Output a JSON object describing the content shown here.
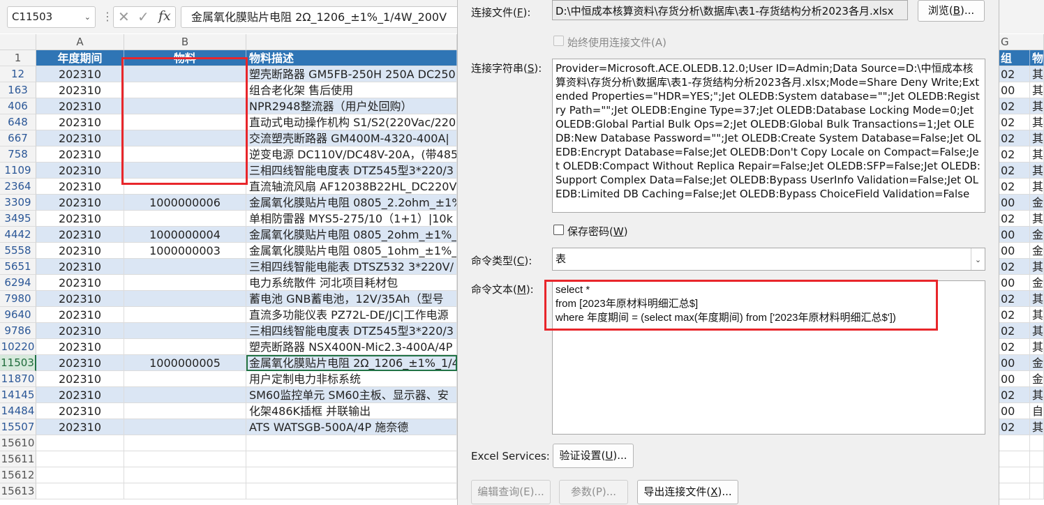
{
  "formula_bar": {
    "name_box": "C11503",
    "cancel_glyph": "✕",
    "enter_glyph": "✓",
    "fx_glyph": "fx",
    "formula": "金属氧化膜贴片电阻 2Ω_1206_±1%_1/4W_200V"
  },
  "columns": {
    "a": "A",
    "b": "B",
    "r": "G"
  },
  "table": {
    "header_row_number": "1",
    "header": {
      "period": "年度期间",
      "material": "物料",
      "description": "物料描述",
      "right_col": "组",
      "far_right": "物"
    },
    "rows": [
      {
        "row": "12",
        "period": "202310",
        "material": "",
        "desc": "塑壳断路器 GM5FB-250H 250A DC250",
        "r": "02",
        "s": "其"
      },
      {
        "row": "163",
        "period": "202310",
        "material": "",
        "desc": "组合老化架 售后使用",
        "r": "00",
        "s": "其"
      },
      {
        "row": "406",
        "period": "202310",
        "material": "",
        "desc": "NPR2948整流器（用户处回购）",
        "r": "02",
        "s": "其"
      },
      {
        "row": "648",
        "period": "202310",
        "material": "",
        "desc": "直动式电动操作机构 S1/S2(220Vac/220",
        "r": "02",
        "s": "其"
      },
      {
        "row": "667",
        "period": "202310",
        "material": "",
        "desc": "交流塑壳断路器 GM400M-4320-400A|",
        "r": "02",
        "s": "其"
      },
      {
        "row": "758",
        "period": "202310",
        "material": "",
        "desc": "逆变电源 DC110V/DC48V-20A，(带485",
        "r": "02",
        "s": "其"
      },
      {
        "row": "1109",
        "period": "202310",
        "material": "",
        "desc": "三相四线智能电度表 DTZ545型3*220/3",
        "r": "02",
        "s": "其"
      },
      {
        "row": "2364",
        "period": "202310",
        "material": "",
        "desc": "直流轴流风扇 AF12038B22HL_DC220V_",
        "r": "02",
        "s": "其"
      },
      {
        "row": "3309",
        "period": "202310",
        "material": "1000000006",
        "desc": "金属氧化膜贴片电阻 0805_2.2ohm_±1%",
        "r": "00",
        "s": "金"
      },
      {
        "row": "3495",
        "period": "202310",
        "material": "",
        "desc": "单相防雷器 MYS5-275/10（1+1）|10k",
        "r": "02",
        "s": "其"
      },
      {
        "row": "4442",
        "period": "202310",
        "material": "1000000004",
        "desc": "金属氧化膜贴片电阻 0805_2ohm_±1%_",
        "r": "00",
        "s": "金"
      },
      {
        "row": "5558",
        "period": "202310",
        "material": "1000000003",
        "desc": "金属氧化膜贴片电阻 0805_1ohm_±1%_",
        "r": "00",
        "s": "金"
      },
      {
        "row": "5651",
        "period": "202310",
        "material": "",
        "desc": "三相四线智能电能表 DTSZ532 3*220V/",
        "r": "02",
        "s": "其"
      },
      {
        "row": "6294",
        "period": "202310",
        "material": "",
        "desc": "电力系统散件 河北项目耗材包",
        "r": "00",
        "s": "金"
      },
      {
        "row": "7980",
        "period": "202310",
        "material": "",
        "desc": "蓄电池 GNB蓄电池，12V/35Ah（型号",
        "r": "02",
        "s": "其"
      },
      {
        "row": "9640",
        "period": "202310",
        "material": "",
        "desc": "直流多功能仪表 PZ72L-DE/JC|工作电源",
        "r": "02",
        "s": "其"
      },
      {
        "row": "9786",
        "period": "202310",
        "material": "",
        "desc": "三相四线智能电度表 DTZ545型3*220/3",
        "r": "02",
        "s": "其"
      },
      {
        "row": "10220",
        "period": "202310",
        "material": "",
        "desc": "塑壳断路器 NSX400N-Mic2.3-400A/4P",
        "r": "02",
        "s": "其"
      },
      {
        "row": "11503",
        "period": "202310",
        "material": "1000000005",
        "desc": "金属氧化膜贴片电阻 2Ω_1206_±1%_1/4",
        "r": "00",
        "s": "金"
      },
      {
        "row": "11870",
        "period": "202310",
        "material": "",
        "desc": "用户定制电力非标系统",
        "r": "00",
        "s": "金"
      },
      {
        "row": "14145",
        "period": "202310",
        "material": "",
        "desc": "SM60监控单元 SM60主板、显示器、安",
        "r": "02",
        "s": "其"
      },
      {
        "row": "14484",
        "period": "202310",
        "material": "",
        "desc": "化架486K插框 并联输出",
        "r": "00",
        "s": "自"
      },
      {
        "row": "15507",
        "period": "202310",
        "material": "",
        "desc": "ATS WATSGB-500A/4P 施奈德",
        "r": "02",
        "s": "其"
      }
    ],
    "empty_rows": [
      "15610",
      "15611",
      "15612",
      "15613"
    ]
  },
  "dialog": {
    "conn_file_label": "连接文件(",
    "conn_file_key": "F",
    "conn_file_tail": "):",
    "conn_file_value": "D:\\中恒成本核算资料\\存货分析\\数据库\\表1-存货结构分析2023各月.xlsx",
    "browse_label": "浏览(",
    "browse_key": "B",
    "browse_tail": ")...",
    "always_use_label": "始终使用连接文件(A)",
    "conn_string_label": "连接字符串(",
    "conn_string_key": "S",
    "conn_string_tail": "):",
    "conn_string": "Provider=Microsoft.ACE.OLEDB.12.0;User ID=Admin;Data Source=D:\\中恒成本核算资料\\存货分析\\数据库\\表1-存货结构分析2023各月.xlsx;Mode=Share Deny Write;Extended Properties=\"HDR=YES;\";Jet OLEDB:System database=\"\";Jet OLEDB:Registry Path=\"\";Jet OLEDB:Engine Type=37;Jet OLEDB:Database Locking Mode=0;Jet OLEDB:Global Partial Bulk Ops=2;Jet OLEDB:Global Bulk Transactions=1;Jet OLEDB:New Database Password=\"\";Jet OLEDB:Create System Database=False;Jet OLEDB:Encrypt Database=False;Jet OLEDB:Don't Copy Locale on Compact=False;Jet OLEDB:Compact Without Replica Repair=False;Jet OLEDB:SFP=False;Jet OLEDB:Support Complex Data=False;Jet OLEDB:Bypass UserInfo Validation=False;Jet OLEDB:Limited DB Caching=False;Jet OLEDB:Bypass ChoiceField Validation=False",
    "save_password_label": "保存密码(",
    "save_password_key": "W",
    "save_password_tail": ")",
    "cmd_type_label": "命令类型(",
    "cmd_type_key": "C",
    "cmd_type_tail": "):",
    "cmd_type_value": "表",
    "cmd_text_label": "命令文本(",
    "cmd_text_key": "M",
    "cmd_text_tail": "):",
    "cmd_text": "select *\nfrom [2023年原材料明细汇总$]\nwhere 年度期间 = (select max(年度期间) from ['2023年原材料明细汇总$'])",
    "excel_services_label": "Excel Services:",
    "auth_label": "验证设置(",
    "auth_key": "U",
    "auth_tail": ")...",
    "edit_query_label": "编辑查询(E)...",
    "params_label": "参数(P)...",
    "export_label": "导出连接文件(",
    "export_key": "X",
    "export_tail": ")..."
  },
  "colors": {
    "header_fill": "#2f75b5",
    "band_fill": "#dbe6f4",
    "highlight_red": "#e8262b",
    "excel_green": "#217346"
  },
  "icons": {
    "dropdown": "chevron-down-icon",
    "filter": "filter-dropdown-icon"
  }
}
